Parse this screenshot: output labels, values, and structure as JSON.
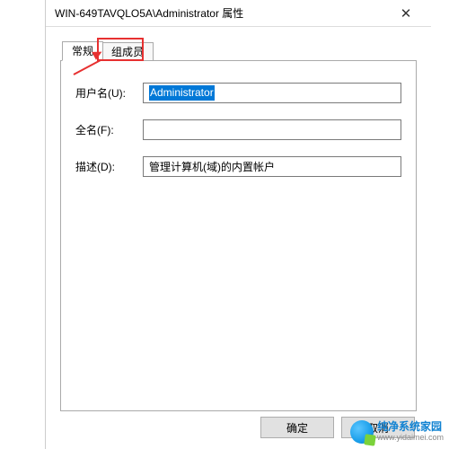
{
  "window": {
    "title": "WIN-649TAVQLO5A\\Administrator 属性",
    "close": "✕"
  },
  "tabs": {
    "general": "常规",
    "members": "组成员"
  },
  "form": {
    "username_label": "用户名(U):",
    "username_value": "Administrator",
    "fullname_label": "全名(F):",
    "fullname_value": "",
    "description_label": "描述(D):",
    "description_value": "管理计算机(域)的内置帐户"
  },
  "buttons": {
    "ok": "确定",
    "cancel": "取消"
  },
  "watermark": {
    "title": "纯净系统家园",
    "url": "www.yidaimei.com"
  }
}
